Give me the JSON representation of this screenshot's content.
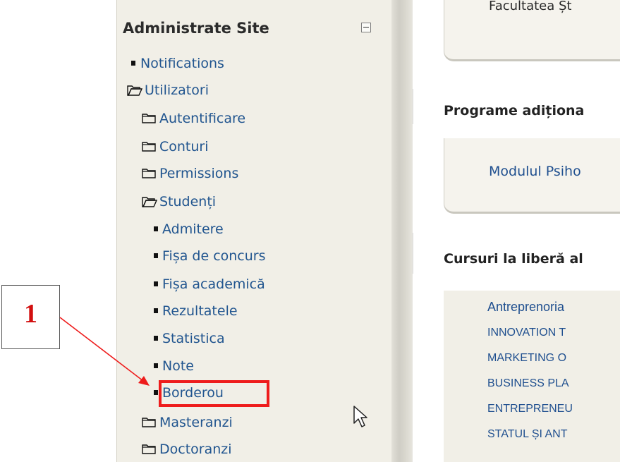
{
  "admin_block": {
    "title": "Administrate Site",
    "items": [
      {
        "label": "Notifications",
        "icon": "bullet-icon"
      },
      {
        "label": "Utilizatori",
        "icon": "folder-open-icon"
      },
      {
        "label": "Autentificare",
        "icon": "folder-icon"
      },
      {
        "label": "Conturi",
        "icon": "folder-icon"
      },
      {
        "label": "Permissions",
        "icon": "folder-icon"
      },
      {
        "label": "Studenți",
        "icon": "folder-open-icon"
      },
      {
        "label": "Admitere",
        "icon": "bullet-icon"
      },
      {
        "label": "Fișa de concurs",
        "icon": "bullet-icon"
      },
      {
        "label": "Fișa academică",
        "icon": "bullet-icon"
      },
      {
        "label": "Rezultatele",
        "icon": "bullet-icon"
      },
      {
        "label": "Statistica",
        "icon": "bullet-icon"
      },
      {
        "label": "Note",
        "icon": "bullet-icon"
      },
      {
        "label": "Borderou",
        "icon": "bullet-icon"
      },
      {
        "label": "Masteranzi",
        "icon": "folder-icon"
      },
      {
        "label": "Doctoranzi",
        "icon": "folder-icon"
      }
    ]
  },
  "right_panel": {
    "top_partial_text": "Facultatea Șt",
    "section_programe": "Programe adiționa",
    "programe_link": "Modulul Psiho",
    "section_cursuri": "Cursuri la liberă al",
    "courses": [
      "Antreprenoria",
      "INNOVATION T",
      "MARKETING O",
      "BUSINESS PLA",
      "ENTREPRENEU",
      "STATUL ȘI ANT"
    ]
  },
  "callout": {
    "number": "1",
    "color": "#d20f0f"
  },
  "colors": {
    "link": "#1f4f8f",
    "highlight": "#ee1c1c",
    "panel_bg": "#f1efe7"
  }
}
